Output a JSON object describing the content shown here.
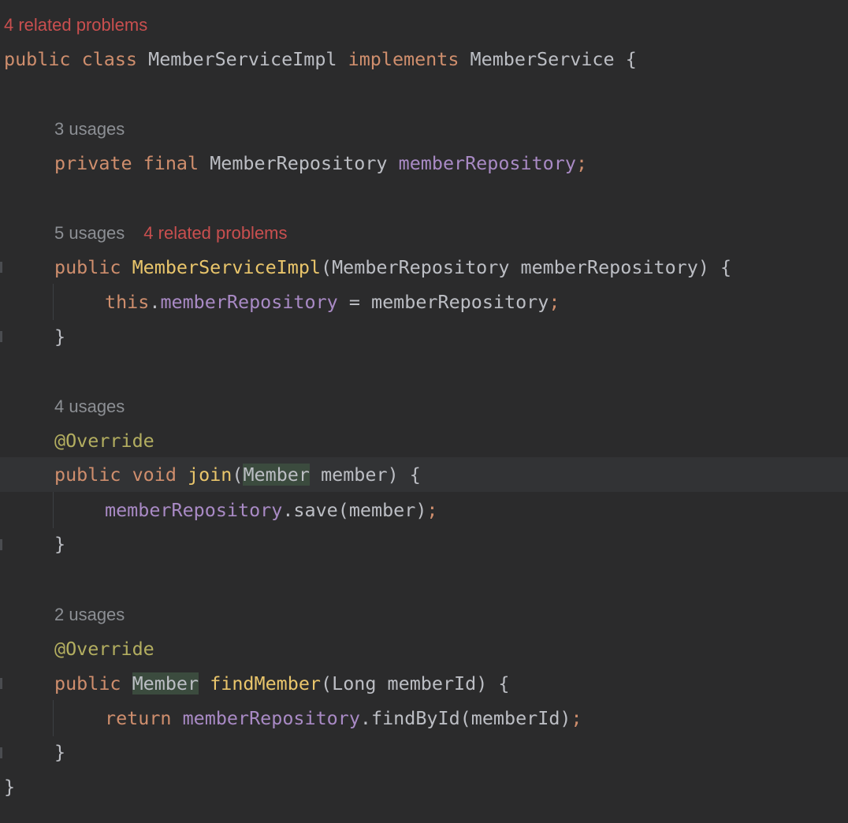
{
  "editor": {
    "class_hints": {
      "problems": "4 related problems"
    },
    "class_decl": {
      "kw_public": "public",
      "kw_class": "class",
      "class_name": "MemberServiceImpl",
      "kw_implements": "implements",
      "interface_name": "MemberService",
      "brace": "{"
    },
    "field_hints": {
      "usages": "3 usages"
    },
    "field_decl": {
      "kw_private": "private",
      "kw_final": "final",
      "type": "MemberRepository",
      "name": "memberRepository",
      "semi": ";"
    },
    "ctor_hints": {
      "usages": "5 usages",
      "problems": "4 related problems"
    },
    "ctor_decl": {
      "kw_public": "public",
      "name": "MemberServiceImpl",
      "open_paren": "(",
      "param_type": "MemberRepository",
      "param_name": "memberRepository",
      "close_paren": ")",
      "brace": "{"
    },
    "ctor_body": {
      "kw_this": "this",
      "dot": ".",
      "field": "memberRepository",
      "assign": " = ",
      "value": "memberRepository",
      "semi": ";"
    },
    "ctor_close": "}",
    "join_hints": {
      "usages": "4 usages"
    },
    "join_annotation": "@Override",
    "join_decl": {
      "kw_public": "public",
      "kw_void": "void",
      "name": "join",
      "open_paren": "(",
      "param_type": "Member",
      "param_name": "member",
      "close_paren": ")",
      "brace": "{"
    },
    "join_body": {
      "field": "memberRepository",
      "call": ".save(member)",
      "semi": ";"
    },
    "join_close": "}",
    "find_hints": {
      "usages": "2 usages"
    },
    "find_annotation": "@Override",
    "find_decl": {
      "kw_public": "public",
      "return_type": "Member",
      "name": "findMember",
      "open_paren": "(",
      "param_type": "Long",
      "param_name": "memberId",
      "close_paren": ")",
      "brace": "{"
    },
    "find_body": {
      "kw_return": "return",
      "field": "memberRepository",
      "call": ".findById(memberId)",
      "semi": ";"
    },
    "find_close": "}",
    "class_close": "}"
  }
}
